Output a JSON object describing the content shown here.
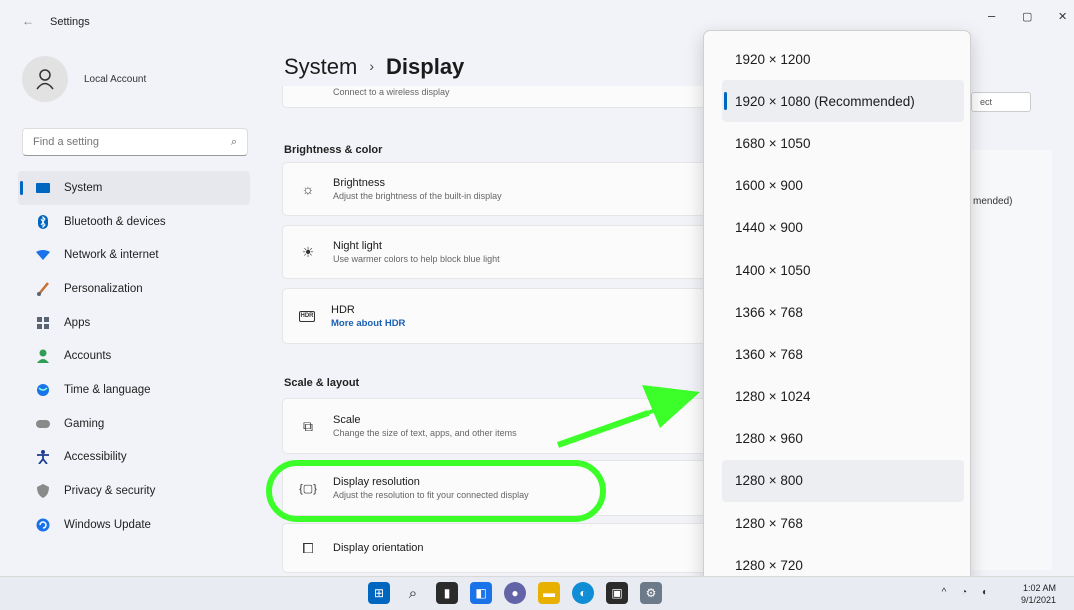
{
  "window": {
    "title": "Settings",
    "back": "←",
    "minimize": "–",
    "maximize": "▢",
    "close": "✕"
  },
  "account": {
    "name": "Local Account"
  },
  "search": {
    "placeholder": "Find a setting"
  },
  "nav": [
    {
      "label": "System",
      "icon": "system-icon",
      "color": "#0067c0"
    },
    {
      "label": "Bluetooth & devices",
      "icon": "bluetooth-icon",
      "color": "#0067c0"
    },
    {
      "label": "Network & internet",
      "icon": "wifi-icon",
      "color": "#1a73e8"
    },
    {
      "label": "Personalization",
      "icon": "brush-icon",
      "color": "#c97030"
    },
    {
      "label": "Apps",
      "icon": "apps-icon",
      "color": "#5a6473"
    },
    {
      "label": "Accounts",
      "icon": "person-icon",
      "color": "#2e9e57"
    },
    {
      "label": "Time & language",
      "icon": "globe-icon",
      "color": "#1a73e8"
    },
    {
      "label": "Gaming",
      "icon": "controller-icon",
      "color": "#888888"
    },
    {
      "label": "Accessibility",
      "icon": "accessibility-icon",
      "color": "#1b1b1b"
    },
    {
      "label": "Privacy & security",
      "icon": "shield-icon",
      "color": "#888888"
    },
    {
      "label": "Windows Update",
      "icon": "update-icon",
      "color": "#1a73e8"
    }
  ],
  "breadcrumb": {
    "parent": "System",
    "separator": "›",
    "current": "Display"
  },
  "partial_card": {
    "subtitle": "Connect to a wireless display"
  },
  "brightness_section": {
    "title": "Brightness & color"
  },
  "cards": {
    "brightness": {
      "title": "Brightness",
      "subtitle": "Adjust the brightness of the built-in display"
    },
    "night_light": {
      "title": "Night light",
      "subtitle": "Use warmer colors to help block blue light"
    },
    "hdr": {
      "title": "HDR",
      "link": "More about HDR",
      "badge": "HDR"
    },
    "scale": {
      "title": "Scale",
      "subtitle": "Change the size of text, apps, and other items"
    },
    "resolution": {
      "title": "Display resolution",
      "subtitle": "Adjust the resolution to fit your connected display"
    },
    "orientation": {
      "title": "Display orientation"
    }
  },
  "scale_section": {
    "title": "Scale & layout"
  },
  "right_panel": {
    "partial_text": "mended)",
    "button_partial": "ect"
  },
  "resolution_dropdown": {
    "options": [
      "1920 × 1200",
      "1920 × 1080 (Recommended)",
      "1680 × 1050",
      "1600 × 900",
      "1440 × 900",
      "1400 × 1050",
      "1366 × 768",
      "1360 × 768",
      "1280 × 1024",
      "1280 × 960",
      "1280 × 800",
      "1280 × 768",
      "1280 × 720"
    ],
    "selected": "1920 × 1080 (Recommended)",
    "hovered": "1280 × 800"
  },
  "taskbar": {
    "icons": [
      {
        "name": "start-icon",
        "color": "#0067c0",
        "glyph": "■"
      },
      {
        "name": "search-icon",
        "color": "#1b1b1b",
        "glyph": "⌕"
      },
      {
        "name": "task-view-icon",
        "color": "#1b1b1b",
        "glyph": "▮"
      },
      {
        "name": "widgets-icon",
        "color": "#1a73e8",
        "glyph": "◧"
      },
      {
        "name": "chat-icon",
        "color": "#6264a7",
        "glyph": "●"
      },
      {
        "name": "file-explorer-icon",
        "color": "#e8b000",
        "glyph": "▬"
      },
      {
        "name": "edge-icon",
        "color": "#0f8ed6",
        "glyph": "◐"
      },
      {
        "name": "store-icon",
        "color": "#2b2b2b",
        "glyph": "▣"
      },
      {
        "name": "settings-taskbar-icon",
        "color": "#6c7a89",
        "glyph": "⚙"
      }
    ],
    "time": "1:02 AM",
    "date": "9/1/2021"
  }
}
